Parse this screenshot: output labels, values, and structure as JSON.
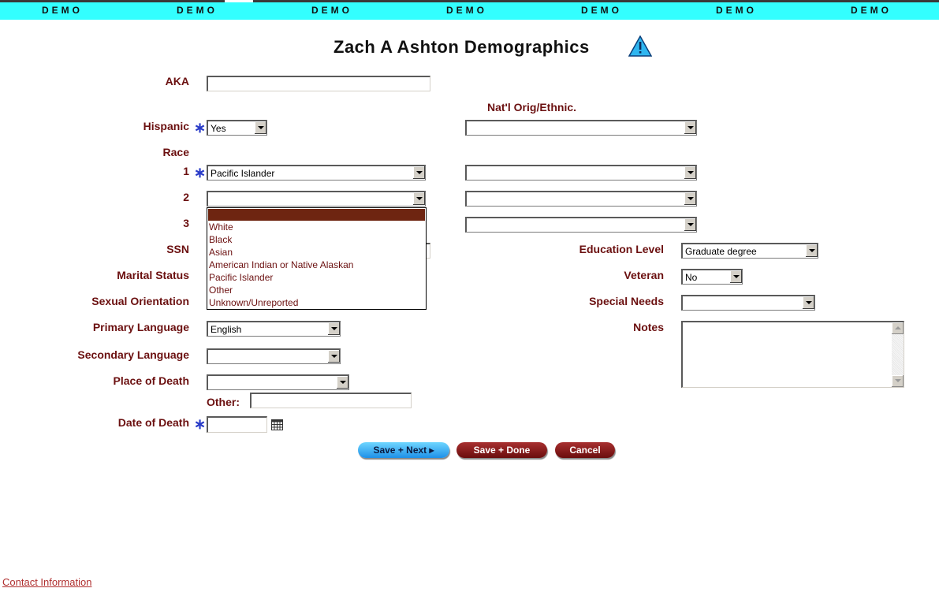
{
  "banner": {
    "items": [
      "DEMO",
      "DEMO",
      "DEMO",
      "DEMO",
      "DEMO",
      "DEMO",
      "DEMO"
    ]
  },
  "page": {
    "title": "Zach A Ashton Demographics"
  },
  "labels": {
    "aka": "AKA",
    "natl_orig": "Nat'l Orig/Ethnic.",
    "hispanic": "Hispanic",
    "race": "Race",
    "race1": "1",
    "race2": "2",
    "race3": "3",
    "ssn": "SSN",
    "marital": "Marital Status",
    "sexual": "Sexual Orientation",
    "primary_lang": "Primary Language",
    "secondary_lang": "Secondary Language",
    "place_death": "Place of Death",
    "other": "Other:",
    "date_death": "Date of Death",
    "education": "Education Level",
    "veteran": "Veteran",
    "special_needs": "Special Needs",
    "notes": "Notes"
  },
  "required_marker": "∗",
  "fields": {
    "aka": "",
    "hispanic": "Yes",
    "natl_orig": "",
    "race1": "Pacific Islander",
    "race1_ethnic": "",
    "race2": "",
    "race2_ethnic": "",
    "race3_ethnic": "",
    "primary_lang": "English",
    "secondary_lang": "",
    "place_death": "",
    "other": "",
    "date_death": "",
    "education": "Graduate degree",
    "veteran": "No",
    "special_needs": "",
    "notes": ""
  },
  "race_dropdown": {
    "options": [
      "",
      "White",
      "Black",
      "Asian",
      "American Indian or Native Alaskan",
      "Pacific Islander",
      "Other",
      "Unknown/Unreported"
    ],
    "highlighted": ""
  },
  "buttons": {
    "save_next": "Save + Next ▸",
    "save_done": "Save + Done",
    "cancel": "Cancel"
  },
  "footer": {
    "contact_link": "Contact Information"
  },
  "colors": {
    "banner": "#33ffff",
    "label": "#6b1010",
    "button_red": "#6a0d0d",
    "button_blue": "#1e90e8",
    "highlight": "#6e2511"
  },
  "icons": {
    "warning": "warning-triangle-icon",
    "calendar": "calendar-icon"
  }
}
